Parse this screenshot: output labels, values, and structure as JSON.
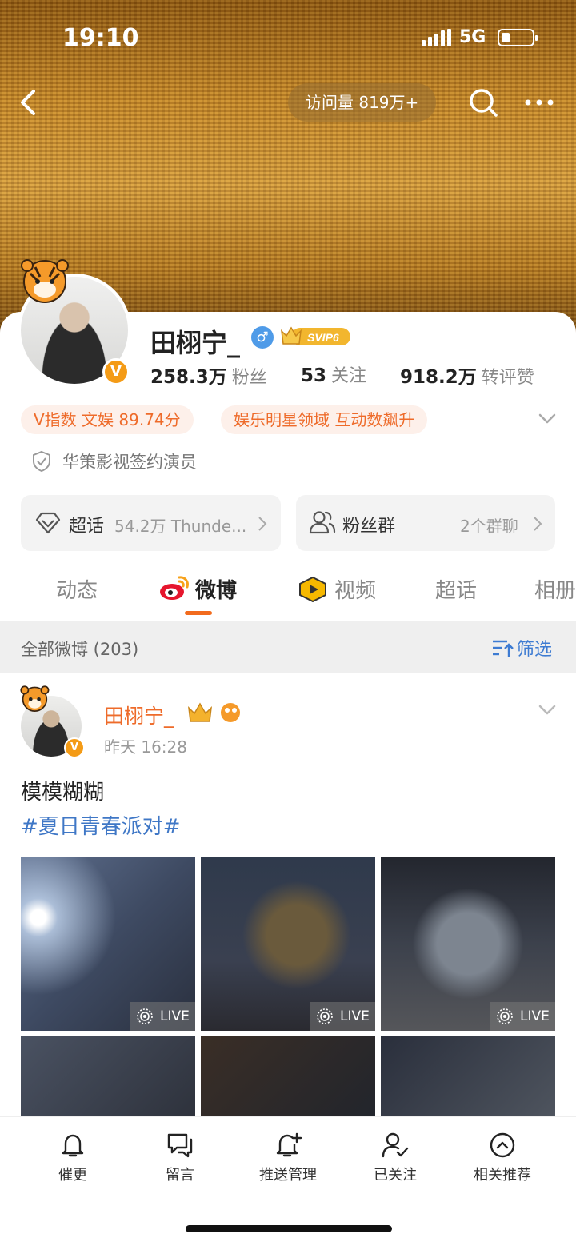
{
  "status_bar": {
    "time": "19:10",
    "network": "5G"
  },
  "nav": {
    "visits": "访问量 819万+"
  },
  "profile": {
    "name": "田栩宁_",
    "gender_symbol": "♂",
    "vip_label": "SVIP6",
    "verified_symbol": "V",
    "stats": [
      {
        "value": "258.3万",
        "label": "粉丝"
      },
      {
        "value": "53",
        "label": "关注"
      },
      {
        "value": "918.2万",
        "label": "转评赞"
      }
    ],
    "tags": [
      "V指数 文娱 89.74分",
      "娱乐明星领域 互动数飙升"
    ],
    "certification": "华策影视签约演员",
    "supertopic": {
      "label": "超话",
      "value": "54.2万 Thunde..."
    },
    "fangroup": {
      "label": "粉丝群",
      "value": "2个群聊"
    }
  },
  "tabs": [
    "动态",
    "微博",
    "视频",
    "超话",
    "相册"
  ],
  "feed_header": {
    "all": "全部微博 (203)",
    "filter": "筛选"
  },
  "post": {
    "author": "田栩宁_",
    "verified_symbol": "V",
    "time": "昨天 16:28",
    "text": "模模糊糊",
    "hashtag": "#夏日青春派对#",
    "live_label": "LIVE"
  },
  "bottom_bar": [
    "催更",
    "留言",
    "推送管理",
    "已关注",
    "相关推荐"
  ],
  "colors": {
    "accent": "#ee6b2a",
    "link": "#3f77c6",
    "tab_indicator": "#f26b1d"
  }
}
